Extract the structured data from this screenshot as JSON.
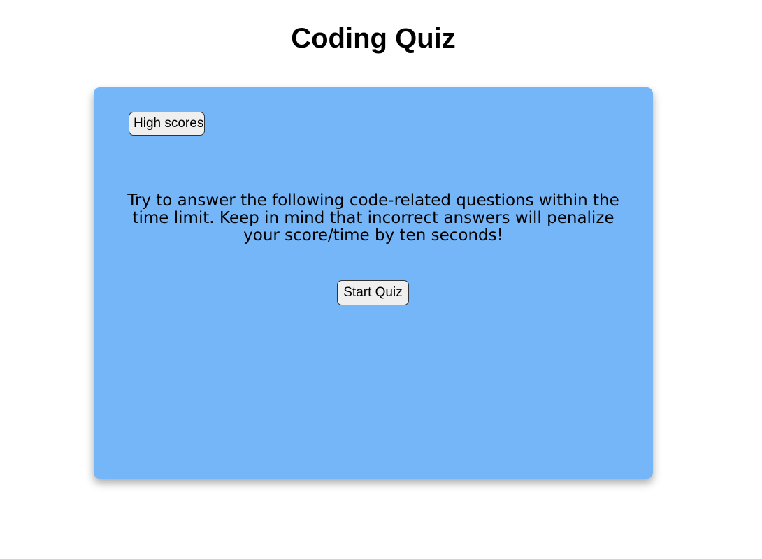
{
  "header": {
    "title": "Coding Quiz"
  },
  "quiz_card": {
    "background_color": "#74b6f8",
    "high_scores_label": "High scores",
    "intro_text": "Try to answer the following code-related questions within the time limit. Keep in mind that incorrect answers will penalize your score/time by ten seconds!",
    "start_label": "Start Quiz"
  }
}
